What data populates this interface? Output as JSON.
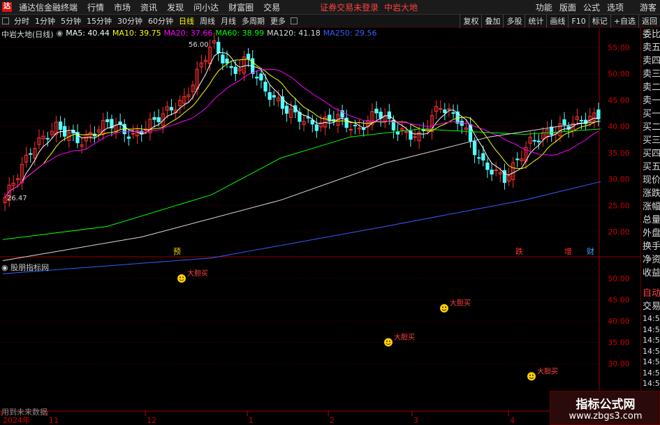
{
  "menubar": {
    "app_title": "通达信金融终端",
    "items": [
      "行情",
      "市场",
      "资讯",
      "发现",
      "问小达",
      "财富圈",
      "交易"
    ],
    "warning": "证券交易未登录",
    "stock": "中岩大地",
    "right_items": [
      "功能",
      "版面",
      "公式",
      "选项"
    ],
    "guest": "游客"
  },
  "toolbar": {
    "periods": [
      "分时",
      "1分钟",
      "5分钟",
      "15分钟",
      "30分钟",
      "60分钟",
      "日线",
      "周线",
      "月线",
      "多周期",
      "更多"
    ],
    "active_period": "日线",
    "right_buttons": [
      "复权",
      "叠加",
      "多股",
      "统计",
      "画线",
      "F10",
      "标记",
      "+自选",
      "返回"
    ]
  },
  "legend": {
    "title": "中岩大地(日线)",
    "mas": [
      {
        "label": "MA5: 40.44",
        "color": "#ffffff"
      },
      {
        "label": "MA10: 39.75",
        "color": "#ffff00"
      },
      {
        "label": "MA20: 37.66",
        "color": "#ff00ff"
      },
      {
        "label": "MA60: 38.99",
        "color": "#00ff00"
      },
      {
        "label": "MA120: 41.18",
        "color": "#dddddd"
      },
      {
        "label": "MA250: 29.56",
        "color": "#3a5cff"
      }
    ]
  },
  "chart_data": {
    "type": "candlestick",
    "price_axis": {
      "ticks": [
        55,
        50,
        45,
        40,
        35,
        30,
        25,
        20
      ],
      "labels": [
        "55.00",
        "50.00",
        "45.00",
        "40.00",
        "35.00",
        "30.00",
        "25.00",
        "20.00"
      ]
    },
    "indicator_axis": {
      "ticks": [
        50,
        45,
        40,
        35,
        30
      ],
      "labels": [
        "50.00",
        "45.00",
        "40.00",
        "35.00",
        "30.00"
      ]
    },
    "date_labels": [
      "2024年",
      "11",
      "12",
      "1",
      "2",
      "3",
      "4"
    ],
    "high_label": "56.00",
    "low_label": "26.47",
    "markers": [
      {
        "text": "预",
        "color": "#ffd000"
      },
      {
        "text": "跌",
        "color": "#ff3030"
      },
      {
        "text": "增",
        "color": "#ff3030"
      },
      {
        "text": "财",
        "color": "#40a0ff"
      }
    ],
    "signals": [
      {
        "label": "大胆买",
        "value": 50
      },
      {
        "label": "大胆买",
        "value": 35
      },
      {
        "label": "大胆买",
        "value": 43
      },
      {
        "label": "大胆买",
        "value": 27
      }
    ],
    "colors": {
      "up": "#ff3232",
      "down": "#54ffff",
      "grid": "#5a0000"
    }
  },
  "indicator": {
    "title": "股朋指标网"
  },
  "footer": {
    "text": "用到未来数据"
  },
  "sidepanel": {
    "items": [
      "委比",
      "卖五",
      "卖四",
      "卖三",
      "卖二",
      "卖一",
      "买一",
      "买二",
      "买三",
      "买四",
      "买五",
      "现价",
      "涨跌",
      "涨幅",
      "总量",
      "外盘",
      "换手",
      "净资",
      "收益"
    ],
    "auto": "自动",
    "trade": "交易",
    "times": [
      "14:56",
      "14:56",
      "14:56",
      "14:56",
      "14:56",
      "14:56",
      "14:56",
      "14:56",
      "14:56",
      "14:56"
    ]
  },
  "watermark": {
    "title": "指标公式网",
    "url": "www.zbgs3.com"
  }
}
